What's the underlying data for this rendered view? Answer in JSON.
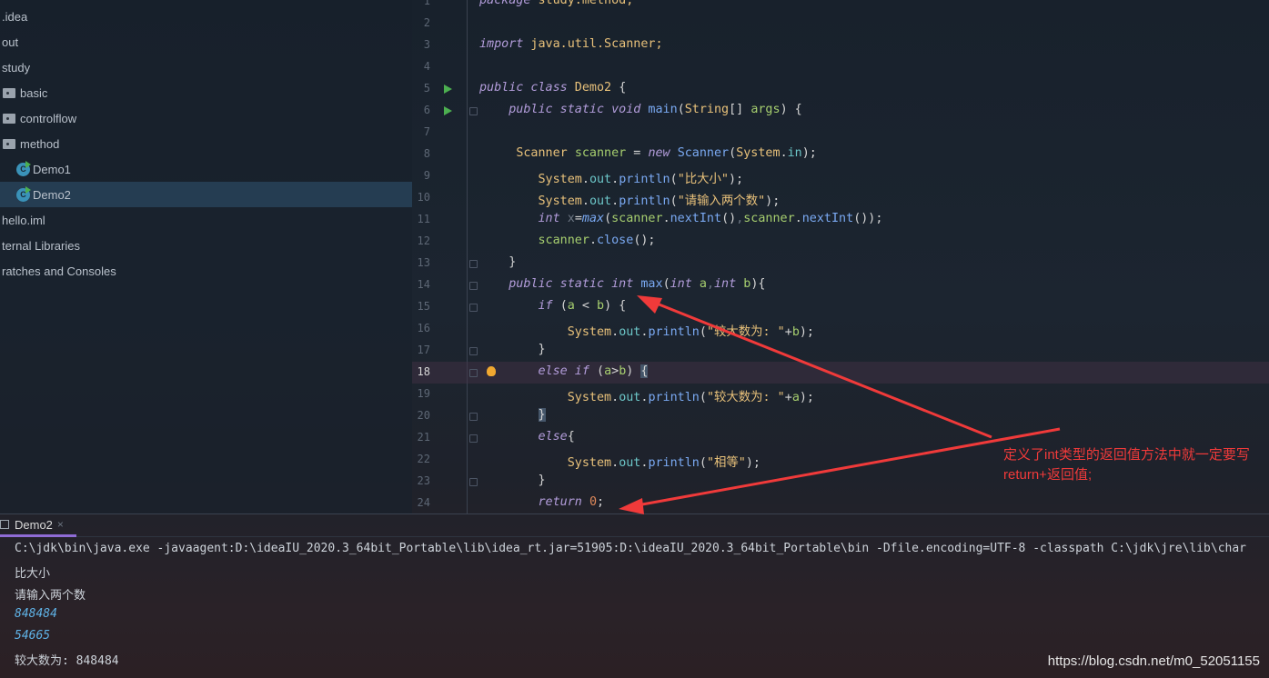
{
  "sidebar": {
    "items": [
      {
        "label": ".idea",
        "icon": "none"
      },
      {
        "label": "out",
        "icon": "none"
      },
      {
        "label": "study",
        "icon": "none"
      },
      {
        "label": "basic",
        "icon": "package-folder-icon"
      },
      {
        "label": "controlflow",
        "icon": "package-folder-icon"
      },
      {
        "label": "method",
        "icon": "package-folder-icon"
      },
      {
        "label": "Demo1",
        "icon": "java-class-icon"
      },
      {
        "label": "Demo2",
        "icon": "java-class-icon",
        "selected": true
      },
      {
        "label": "hello.iml",
        "icon": "none"
      },
      {
        "label": "ternal Libraries",
        "icon": "none"
      },
      {
        "label": "ratches and Consoles",
        "icon": "none"
      }
    ],
    "class_icon_letter": "C"
  },
  "editor": {
    "current_line": 18,
    "lines": [
      {
        "n": "1",
        "t": [
          [
            "package",
            "kw"
          ],
          [
            " study.method;",
            "ty"
          ]
        ]
      },
      {
        "n": "2",
        "t": []
      },
      {
        "n": "3",
        "t": [
          [
            "import",
            "kw"
          ],
          [
            " java.util.Scanner;",
            "ty"
          ]
        ]
      },
      {
        "n": "4",
        "t": []
      },
      {
        "n": "5",
        "run": true,
        "t": [
          [
            "public class",
            "kw"
          ],
          [
            " Demo2 ",
            "ty"
          ],
          [
            "{",
            "pu"
          ]
        ]
      },
      {
        "n": "6",
        "run": true,
        "fold": true,
        "t": [
          [
            "    "
          ],
          [
            "public static void",
            "kw"
          ],
          [
            " main",
            "me"
          ],
          [
            "(",
            "pu"
          ],
          [
            "String",
            "ty"
          ],
          [
            "[] ",
            "pu"
          ],
          [
            "args",
            "va"
          ],
          [
            ") {",
            "pu"
          ]
        ]
      },
      {
        "n": "7",
        "t": []
      },
      {
        "n": "8",
        "t": [
          [
            "     "
          ],
          [
            "Scanner ",
            "ty"
          ],
          [
            "scanner",
            "va"
          ],
          [
            " = ",
            "pu"
          ],
          [
            "new ",
            "kw"
          ],
          [
            "Scanner",
            "me"
          ],
          [
            "(",
            "pu"
          ],
          [
            "System",
            "ty"
          ],
          [
            ".",
            "pu"
          ],
          [
            "in",
            "fi"
          ],
          [
            ");",
            "pu"
          ]
        ]
      },
      {
        "n": "9",
        "t": [
          [
            "        "
          ],
          [
            "System",
            "ty"
          ],
          [
            ".",
            "pu"
          ],
          [
            "out",
            "fi"
          ],
          [
            ".",
            "pu"
          ],
          [
            "println",
            "me"
          ],
          [
            "(",
            "pu"
          ],
          [
            "\"比大小\"",
            "st"
          ],
          [
            ");",
            "pu"
          ]
        ]
      },
      {
        "n": "10",
        "t": [
          [
            "        "
          ],
          [
            "System",
            "ty"
          ],
          [
            ".",
            "pu"
          ],
          [
            "out",
            "fi"
          ],
          [
            ".",
            "pu"
          ],
          [
            "println",
            "me"
          ],
          [
            "(",
            "pu"
          ],
          [
            "\"请输入两个数\"",
            "st"
          ],
          [
            ");",
            "pu"
          ]
        ]
      },
      {
        "n": "11",
        "t": [
          [
            "        "
          ],
          [
            "int ",
            "kw"
          ],
          [
            "x",
            "gr"
          ],
          [
            "=",
            "pu"
          ],
          [
            "max",
            "it"
          ],
          [
            "(",
            "pu"
          ],
          [
            "scanner",
            "va"
          ],
          [
            ".",
            "pu"
          ],
          [
            "nextInt",
            "me"
          ],
          [
            "()",
            "pu"
          ],
          [
            ",",
            "gr"
          ],
          [
            "scanner",
            "va"
          ],
          [
            ".",
            "pu"
          ],
          [
            "nextInt",
            "me"
          ],
          [
            "());",
            "pu"
          ]
        ]
      },
      {
        "n": "12",
        "t": [
          [
            "        "
          ],
          [
            "scanner",
            "va"
          ],
          [
            ".",
            "pu"
          ],
          [
            "close",
            "me"
          ],
          [
            "();",
            "pu"
          ]
        ]
      },
      {
        "n": "13",
        "fold": true,
        "t": [
          [
            "    "
          ],
          [
            "}",
            "pu"
          ]
        ]
      },
      {
        "n": "14",
        "fold": true,
        "t": [
          [
            "    "
          ],
          [
            "public static int",
            "kw"
          ],
          [
            " max",
            "me"
          ],
          [
            "(",
            "pu"
          ],
          [
            "int ",
            "kw"
          ],
          [
            "a",
            "va"
          ],
          [
            ",",
            "gr"
          ],
          [
            "int ",
            "kw"
          ],
          [
            "b",
            "va"
          ],
          [
            "){",
            "pu"
          ]
        ]
      },
      {
        "n": "15",
        "fold": true,
        "t": [
          [
            "        "
          ],
          [
            "if ",
            "kw"
          ],
          [
            "(",
            "pu"
          ],
          [
            "a",
            "va"
          ],
          [
            " < ",
            "pu"
          ],
          [
            "b",
            "va"
          ],
          [
            ") {",
            "pu"
          ]
        ]
      },
      {
        "n": "16",
        "t": [
          [
            "            "
          ],
          [
            "System",
            "ty"
          ],
          [
            ".",
            "pu"
          ],
          [
            "out",
            "fi"
          ],
          [
            ".",
            "pu"
          ],
          [
            "println",
            "me"
          ],
          [
            "(",
            "pu"
          ],
          [
            "\"较大数为: \"",
            "st"
          ],
          [
            "+",
            "pu"
          ],
          [
            "b",
            "va"
          ],
          [
            ");",
            "pu"
          ]
        ]
      },
      {
        "n": "17",
        "fold": true,
        "t": [
          [
            "        "
          ],
          [
            "}",
            "pu"
          ]
        ]
      },
      {
        "n": "18",
        "fold": true,
        "bulb": true,
        "t": [
          [
            "        "
          ],
          [
            "else if ",
            "kw"
          ],
          [
            "(",
            "pu"
          ],
          [
            "a",
            "va"
          ],
          [
            ">",
            "pu"
          ],
          [
            "b",
            "va"
          ],
          [
            ") ",
            "pu"
          ],
          [
            "{",
            "brk"
          ]
        ]
      },
      {
        "n": "19",
        "t": [
          [
            "            "
          ],
          [
            "System",
            "ty"
          ],
          [
            ".",
            "pu"
          ],
          [
            "out",
            "fi"
          ],
          [
            ".",
            "pu"
          ],
          [
            "println",
            "me"
          ],
          [
            "(",
            "pu"
          ],
          [
            "\"较大数为: \"",
            "st"
          ],
          [
            "+",
            "pu"
          ],
          [
            "a",
            "va"
          ],
          [
            ");",
            "pu"
          ]
        ]
      },
      {
        "n": "20",
        "fold": true,
        "t": [
          [
            "        "
          ],
          [
            "}",
            "brk"
          ]
        ]
      },
      {
        "n": "21",
        "fold": true,
        "t": [
          [
            "        "
          ],
          [
            "else",
            "kw"
          ],
          [
            "{",
            "pu"
          ]
        ]
      },
      {
        "n": "22",
        "t": [
          [
            "            "
          ],
          [
            "System",
            "ty"
          ],
          [
            ".",
            "pu"
          ],
          [
            "out",
            "fi"
          ],
          [
            ".",
            "pu"
          ],
          [
            "println",
            "me"
          ],
          [
            "(",
            "pu"
          ],
          [
            "\"相等\"",
            "st"
          ],
          [
            ");",
            "pu"
          ]
        ]
      },
      {
        "n": "23",
        "fold": true,
        "t": [
          [
            "        "
          ],
          [
            "}",
            "pu"
          ]
        ]
      },
      {
        "n": "24",
        "t": [
          [
            "        "
          ],
          [
            "return ",
            "kw"
          ],
          [
            "0",
            "nu"
          ],
          [
            ";",
            "pu"
          ]
        ]
      }
    ]
  },
  "console": {
    "tab_label": "Demo2",
    "close_glyph": "×",
    "lines": [
      {
        "text": "C:\\jdk\\bin\\java.exe -javaagent:D:\\ideaIU_2020.3_64bit_Portable\\lib\\idea_rt.jar=51905:D:\\ideaIU_2020.3_64bit_Portable\\bin -Dfile.encoding=UTF-8 -classpath C:\\jdk\\jre\\lib\\char",
        "input": false
      },
      {
        "text": "比大小",
        "input": false
      },
      {
        "text": "请输入两个数",
        "input": false
      },
      {
        "text": "848484",
        "input": true
      },
      {
        "text": "54665",
        "input": true
      },
      {
        "text": "较大数为: 848484",
        "input": false
      }
    ]
  },
  "annotation": {
    "text": "定义了int类型的返回值方法中就一定要写return+返回值;",
    "color": "#f03a3a"
  },
  "watermark": "https://blog.csdn.net/m0_52051155"
}
